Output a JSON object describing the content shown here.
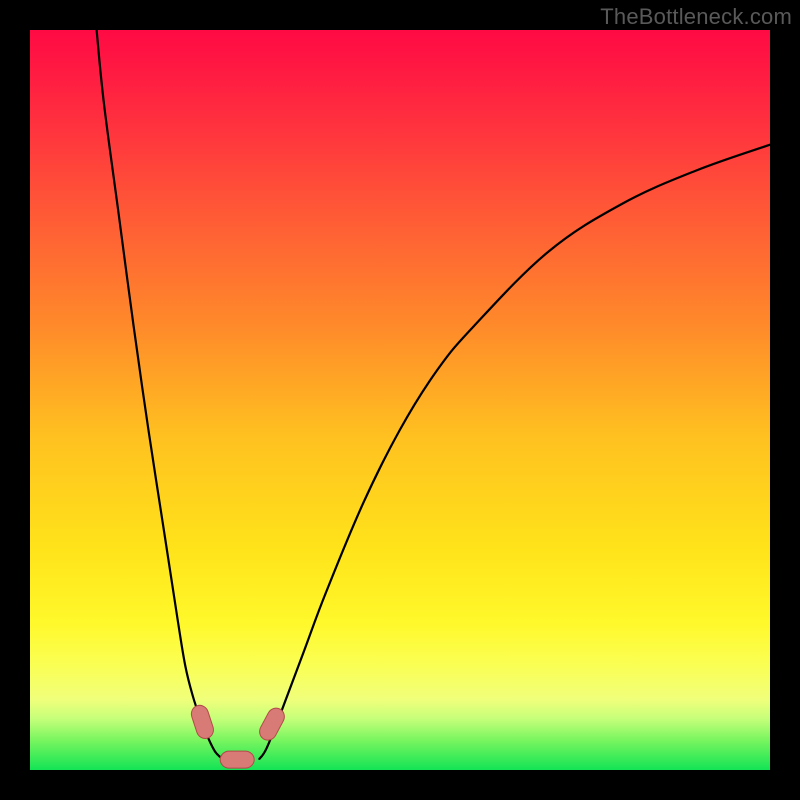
{
  "watermark": "TheBottleneck.com",
  "chart_data": {
    "type": "line",
    "title": "",
    "xlabel": "",
    "ylabel": "",
    "xlim": [
      0,
      100
    ],
    "ylim": [
      0,
      100
    ],
    "curves": [
      {
        "name": "left-branch",
        "x": [
          9,
          10,
          12,
          14,
          16,
          18,
          20,
          21,
          22,
          23,
          24,
          25,
          26
        ],
        "y": [
          100,
          90,
          75,
          60,
          46,
          33,
          20,
          14,
          10,
          7,
          4.5,
          2.5,
          1.5
        ]
      },
      {
        "name": "right-branch",
        "x": [
          31,
          32,
          34,
          37,
          40,
          45,
          50,
          55,
          60,
          70,
          80,
          90,
          100
        ],
        "y": [
          1.5,
          3,
          8,
          16,
          24,
          36,
          46,
          54,
          60,
          70,
          76.5,
          81,
          84.5
        ]
      }
    ],
    "markers": [
      {
        "name": "pill-left",
        "x": 23.3,
        "y": 6.5,
        "angle": 72
      },
      {
        "name": "pill-right",
        "x": 32.7,
        "y": 6.2,
        "angle": -62
      },
      {
        "name": "pill-bottom",
        "x": 28.0,
        "y": 1.4,
        "angle": 0
      }
    ],
    "bottom_band_color": "#12e455",
    "band_top_color": "#f0ff7b",
    "gradient_stops": [
      {
        "offset": 0.0,
        "color": "#ff0a44"
      },
      {
        "offset": 0.1,
        "color": "#ff2840"
      },
      {
        "offset": 0.25,
        "color": "#ff5a36"
      },
      {
        "offset": 0.4,
        "color": "#ff8a2a"
      },
      {
        "offset": 0.55,
        "color": "#ffc120"
      },
      {
        "offset": 0.7,
        "color": "#ffe31a"
      },
      {
        "offset": 0.8,
        "color": "#fff82a"
      },
      {
        "offset": 0.86,
        "color": "#faff55"
      },
      {
        "offset": 0.905,
        "color": "#f0ff7b"
      },
      {
        "offset": 0.93,
        "color": "#c7ff7a"
      },
      {
        "offset": 0.96,
        "color": "#78f55f"
      },
      {
        "offset": 1.0,
        "color": "#12e455"
      }
    ],
    "marker_style": {
      "fill": "#d87a76",
      "stroke": "#b24b49",
      "rx": 9,
      "width": 34,
      "height": 17
    }
  }
}
